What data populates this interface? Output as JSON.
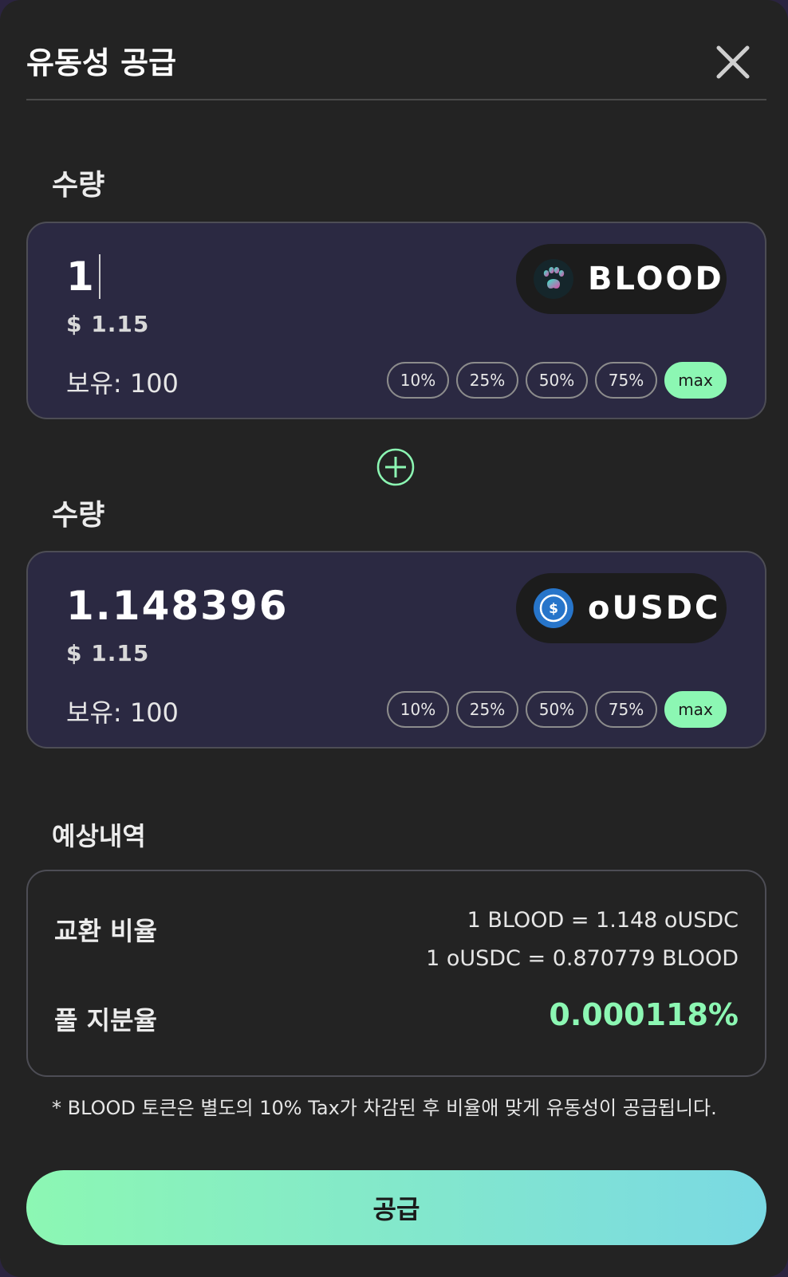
{
  "modal": {
    "title": "유동성 공급"
  },
  "token_a": {
    "section_label": "수량",
    "amount": "1",
    "usd_value": "$ 1.15",
    "balance": "보유: 100",
    "token_name": "BLOOD",
    "token_icon": "paw-icon",
    "percent_buttons": [
      "10%",
      "25%",
      "50%",
      "75%",
      "max"
    ]
  },
  "token_b": {
    "section_label": "수량",
    "amount": "1.148396",
    "usd_value": "$ 1.15",
    "balance": "보유: 100",
    "token_name": "oUSDC",
    "token_icon": "usdc-icon",
    "percent_buttons": [
      "10%",
      "25%",
      "50%",
      "75%",
      "max"
    ]
  },
  "estimate": {
    "section_label": "예상내역",
    "rate_label": "교환 비율",
    "rate_line1": "1 BLOOD = 1.148 oUSDC",
    "rate_line2": "1 oUSDC = 0.870779 BLOOD",
    "share_label": "풀 지분율",
    "share_value": "0.000118%"
  },
  "note": "* BLOOD 토큰은 별도의 10% Tax가 차감된 후 비율애 맞게 유동성이 공급됩니다.",
  "submit_label": "공급",
  "colors": {
    "accent": "#8cf7b3",
    "gradient_end": "#7ad9e3",
    "panel": "#2b2942",
    "background": "#232323"
  }
}
